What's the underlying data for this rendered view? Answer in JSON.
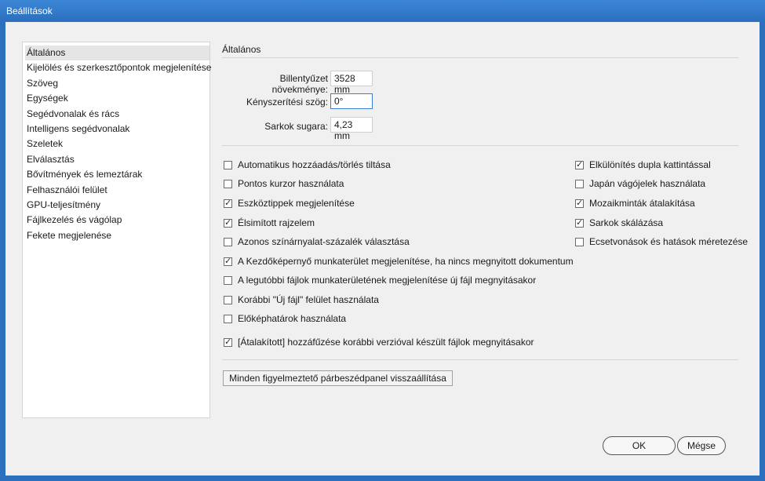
{
  "window": {
    "title": "Beállítások"
  },
  "sidebar": {
    "items": [
      {
        "label": "Általános",
        "selected": true
      },
      {
        "label": "Kijelölés és szerkesztőpontok megjelenítése"
      },
      {
        "label": "Szöveg"
      },
      {
        "label": "Egységek"
      },
      {
        "label": "Segédvonalak és rács"
      },
      {
        "label": "Intelligens segédvonalak"
      },
      {
        "label": "Szeletek"
      },
      {
        "label": "Elválasztás"
      },
      {
        "label": "Bővítmények és lemeztárak"
      },
      {
        "label": "Felhasználói felület"
      },
      {
        "label": "GPU-teljesítmény"
      },
      {
        "label": "Fájlkezelés és vágólap"
      },
      {
        "label": "Fekete megjelenése"
      }
    ]
  },
  "main": {
    "section_title": "Általános",
    "fields": {
      "keyboard_increment": {
        "label": "Billentyűzet növekménye:",
        "value": "3528 mm"
      },
      "constrain_angle": {
        "label": "Kényszerítési szög:",
        "value": "0°"
      },
      "corner_radius": {
        "label": "Sarkok sugara:",
        "value": "4,23 mm"
      }
    },
    "checkboxes_left": [
      {
        "label": "Automatikus hozzáadás/törlés tiltása",
        "checked": false
      },
      {
        "label": "Pontos kurzor használata",
        "checked": false
      },
      {
        "label": "Eszköztippek megjelenítése",
        "checked": true
      },
      {
        "label": "Élsimított rajzelem",
        "checked": true
      },
      {
        "label": "Azonos színárnyalat-százalék választása",
        "checked": false
      },
      {
        "label": "A Kezdőképernyő munkaterület megjelenítése, ha nincs megnyitott dokumentum",
        "checked": true
      },
      {
        "label": "A legutóbbi fájlok munkaterületének megjelenítése új fájl megnyitásakor",
        "checked": false
      },
      {
        "label": "Korábbi \"Új fájl\" felület használata",
        "checked": false
      },
      {
        "label": "Előképhatárok használata",
        "checked": false
      },
      {
        "label": "[Átalakított] hozzáfűzése korábbi verzióval készült fájlok megnyitásakor",
        "checked": true
      }
    ],
    "checkboxes_right": [
      {
        "label": "Elkülönítés dupla kattintással",
        "checked": true
      },
      {
        "label": "Japán vágójelek használata",
        "checked": false
      },
      {
        "label": "Mozaikminták átalakítása",
        "checked": true
      },
      {
        "label": "Sarkok skálázása",
        "checked": true
      },
      {
        "label": "Ecsetvonások és hatások méretezése",
        "checked": false
      }
    ],
    "reset_button": "Minden figyelmeztető párbeszédpanel visszaállítása"
  },
  "footer": {
    "ok_label": "OK",
    "cancel_label": "Mégse"
  },
  "colors": {
    "titlebar": "#2b6fbe",
    "focus": "#3a7fd0"
  }
}
